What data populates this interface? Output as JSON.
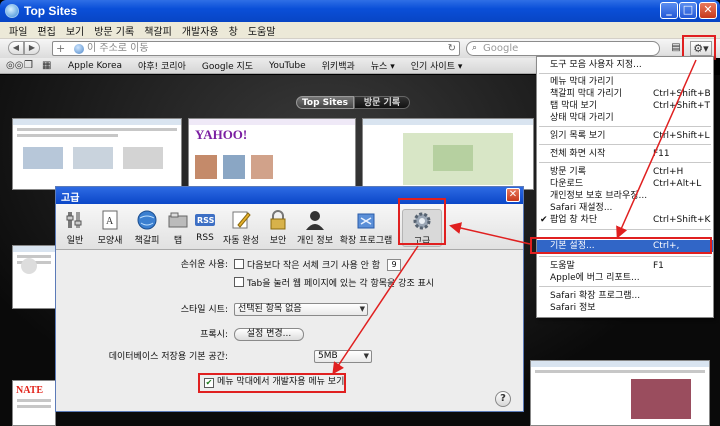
{
  "window": {
    "title": "Top Sites"
  },
  "menubar": {
    "items": [
      "파일",
      "편집",
      "보기",
      "방문 기록",
      "책갈피",
      "개발자용",
      "창",
      "도움말"
    ]
  },
  "toolbar": {
    "address_placeholder": "이 주소로 이동",
    "search_placeholder": "Google",
    "icons": {
      "back": "back-arrow-icon",
      "forward": "forward-arrow-icon",
      "add": "plus-icon",
      "reload": "reload-icon",
      "page": "page-icon",
      "gear": "gear-icon"
    }
  },
  "bookmarks": {
    "items": [
      "Apple Korea",
      "야후! 코리아",
      "Google 지도",
      "YouTube",
      "위키백과",
      "뉴스 ▾",
      "인기 사이트 ▾"
    ]
  },
  "topsites": {
    "segments": [
      "Top Sites",
      "방문 기록"
    ],
    "thumb_labels": [
      "YAHOO!",
      "NATE"
    ]
  },
  "action_menu": {
    "items": [
      {
        "label": "도구 모음 사용자 지정...",
        "shortcut": ""
      },
      {
        "label": "메뉴 막대 가리기",
        "shortcut": ""
      },
      {
        "label": "책갈피 막대 가리기",
        "shortcut": "Ctrl+Shift+B"
      },
      {
        "label": "탭 막대 보기",
        "shortcut": "Ctrl+Shift+T"
      },
      {
        "label": "상태 막대 가리기",
        "shortcut": ""
      },
      {
        "label": "읽기 목록 보기",
        "shortcut": "Ctrl+Shift+L"
      },
      {
        "label": "전체 화면 시작",
        "shortcut": "F11"
      },
      {
        "label": "방문 기록",
        "shortcut": "Ctrl+H"
      },
      {
        "label": "다운로드",
        "shortcut": "Ctrl+Alt+L"
      },
      {
        "label": "개인정보 보호 브라우징...",
        "shortcut": ""
      },
      {
        "label": "Safari 재설정...",
        "shortcut": ""
      },
      {
        "label": "팝업 창 차단",
        "shortcut": "Ctrl+Shift+K",
        "checked": true
      },
      {
        "label": "기본 설정...",
        "shortcut": "Ctrl+,",
        "highlighted": true
      },
      {
        "label": "도움말",
        "shortcut": "F1"
      },
      {
        "label": "Apple에 버그 리포트...",
        "shortcut": ""
      },
      {
        "label": "Safari 확장 프로그램...",
        "shortcut": ""
      },
      {
        "label": "Safari 정보",
        "shortcut": ""
      }
    ],
    "check_mark": "✔"
  },
  "prefs": {
    "title": "고급",
    "tabs": [
      "일반",
      "모양새",
      "책갈피",
      "탭",
      "RSS",
      "자동 완성",
      "보안",
      "개인 정보",
      "확장 프로그램",
      "고급"
    ],
    "selected_tab": "고급",
    "accessibility_label": "손쉬운 사용:",
    "min_font_option": "다음보다 작은 서체 크기 사용 안 함",
    "min_font_value": "9",
    "tab_highlight_option": "Tab을 눌러 웹 페이지에 있는 각 항목을 강조 표시",
    "stylesheet_label": "스타일 시트:",
    "stylesheet_value": "선택된 항목 없음",
    "proxy_label": "프록시:",
    "proxy_button": "설정 변경...",
    "db_label": "데이터베이스 저장용 기본 공간:",
    "db_value": "5MB",
    "develop_menu_option": "메뉴 막대에서 개발자용 메뉴 보기",
    "develop_menu_checked": true,
    "check_mark": "✔",
    "help": "?"
  },
  "annotation_color": "#e02020"
}
